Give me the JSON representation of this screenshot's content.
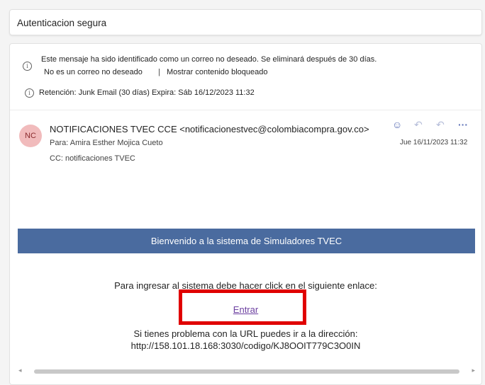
{
  "subject": "Autenticacion segura",
  "junk_notice": {
    "message": "Este mensaje ha sido identificado como un correo no deseado. Se eliminará después de 30 días.",
    "not_junk_link": "No es un correo no deseado",
    "separator": "|",
    "show_blocked_link": "Mostrar contenido bloqueado",
    "retention": "Retención: Junk Email (30 días) Expira: Sáb 16/12/2023 11:32"
  },
  "header": {
    "avatar_initials": "NC",
    "sender": "NOTIFICACIONES TVEC CCE <notificacionestvec@colombiacompra.gov.co>",
    "to": "Para:  Amira Esther Mojica Cueto",
    "cc": "CC:  notificaciones TVEC",
    "date": "Jue 16/11/2023 11:32",
    "actions": {
      "emoji": "☺",
      "reply": "↶",
      "reply_all": "↶",
      "more": "···"
    }
  },
  "body": {
    "banner": "Bienvenido a la sistema de Simuladores TVEC",
    "instruction": "Para ingresar al sistema debe hacer click en el siguiente enlace:",
    "link_text": "Entrar",
    "problem_text": "Si tienes problema con la URL puedes ir a la dirección:",
    "url": "http://158.101.18.168:3030/codigo/KJ8OOIT779C3O0IN"
  },
  "scrollbar": {
    "left_arrow": "◂",
    "right_arrow": "▸"
  },
  "colors": {
    "banner": "#4a6b9f",
    "highlight": "#e00000",
    "link": "#6b3fa0",
    "avatar_bg": "#f1bbbc"
  }
}
